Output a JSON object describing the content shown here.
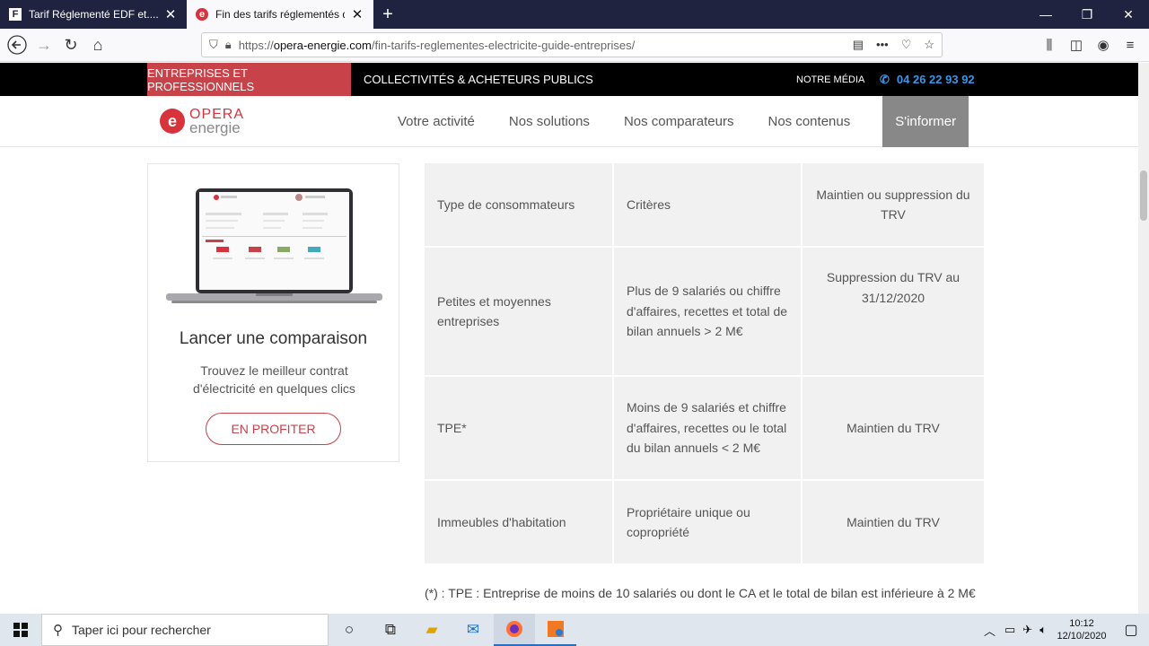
{
  "browser": {
    "tabs": [
      {
        "title": "Tarif Réglementé EDF et.....EJP",
        "favicon": "F",
        "active": false
      },
      {
        "title": "Fin des tarifs réglementés de l'é",
        "favicon": "e",
        "active": true
      }
    ],
    "url_prefix": "https://",
    "url_domain": "opera-energie.com",
    "url_path": "/fin-tarifs-reglementes-electricite-guide-entreprises/"
  },
  "topstrip": {
    "pro": "ENTREPRISES ET PROFESSIONNELS",
    "collectivites": "COLLECTIVITÉS & ACHETEURS PUBLICS",
    "media": "NOTRE MÉDIA",
    "phone": "04 26 22 93 92"
  },
  "logo": {
    "line1": "OPERA",
    "line2": "energie"
  },
  "menu": [
    "Votre activité",
    "Nos solutions",
    "Nos comparateurs",
    "Nos contenus",
    "S'informer"
  ],
  "card": {
    "title": "Lancer une comparaison",
    "text": "Trouvez le meilleur contrat d'électricité en quelques clics",
    "cta": "EN PROFITER"
  },
  "table": {
    "rows": [
      [
        "Type de consommateurs",
        "Critères",
        "Maintien ou suppression du TRV"
      ],
      [
        "Petites et moyennes entreprises",
        "Plus de 9 salariés ou chiffre d'affaires, recettes et total de bilan annuels > 2 M€",
        "Suppression du TRV au 31/12/2020"
      ],
      [
        "TPE*",
        "Moins de 9 salariés et chiffre d'affaires, recettes ou le total du bilan annuels < 2 M€",
        "Maintien du TRV"
      ],
      [
        "Immeubles d'habitation",
        "Propriétaire unique ou copropriété",
        "Maintien du TRV"
      ]
    ]
  },
  "footnote": "(*) : TPE : Entreprise de moins de 10 salariés ou dont le CA et le total de bilan est inférieure à 2 M€",
  "taskbar": {
    "search_placeholder": "Taper ici pour rechercher",
    "time": "10:12",
    "date": "12/10/2020"
  }
}
